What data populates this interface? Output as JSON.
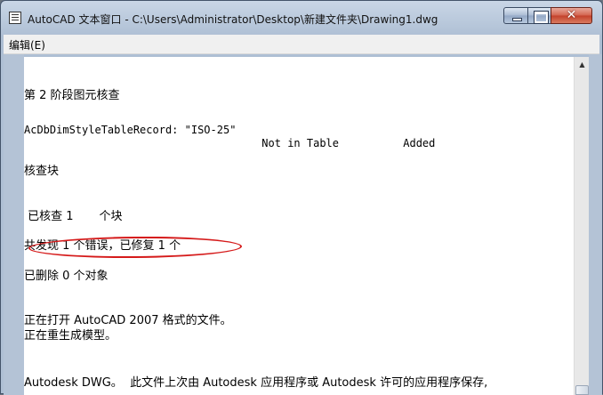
{
  "window": {
    "title": "AutoCAD 文本窗口 - C:\\Users\\Administrator\\Desktop\\新建文件夹\\Drawing1.dwg",
    "close_glyph": "✕"
  },
  "menu": {
    "edit_label": "编辑(E)"
  },
  "scrollbar": {
    "up_arrow": "▲"
  },
  "text_lines": {
    "l1": "第 2 阶段图元核查",
    "l2": "AcDbDimStyleTableRecord: \"ISO-25\"",
    "l3": "                                     Not in Table          Added",
    "l4": "核查块",
    "l5": " 已核查 1       个块",
    "l6": "共发现 1 个错误，已修复 1 个",
    "l7": "已删除 0 个对象",
    "l8": "正在打开 AutoCAD 2007 格式的文件。",
    "l9": "正在重生成模型。",
    "l10": "Autodesk DWG。  此文件上次由 Autodesk 应用程序或 Autodesk 许可的应用程序保存,"
  },
  "annotation": {
    "color": "#d51a1a"
  }
}
